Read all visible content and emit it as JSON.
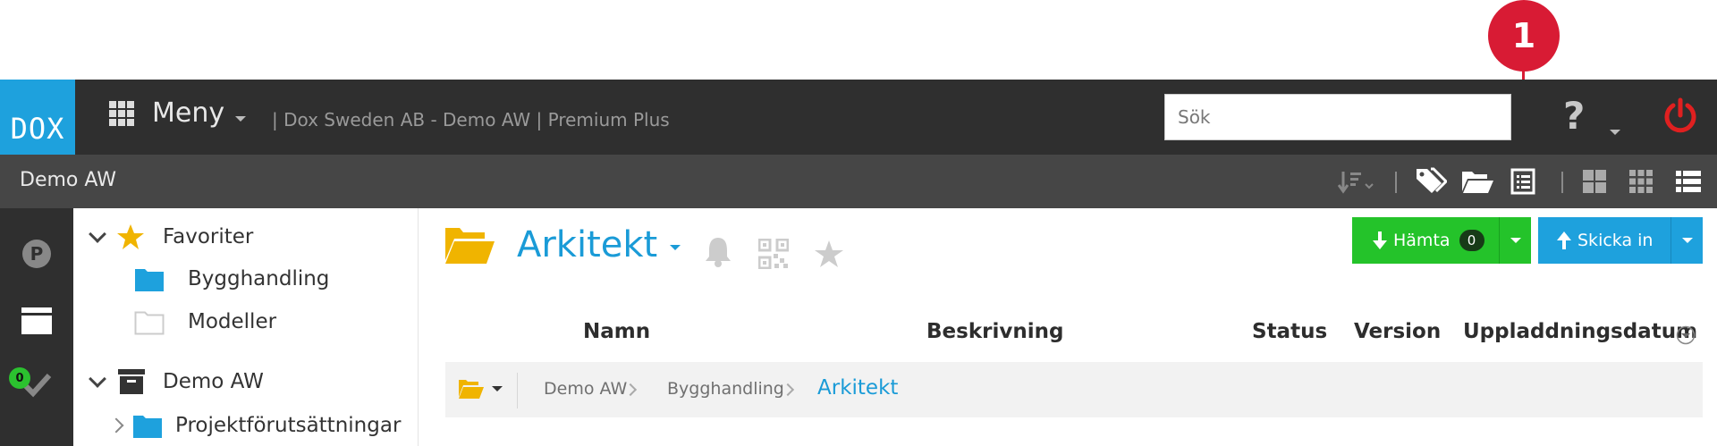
{
  "callout": {
    "number": "1"
  },
  "header": {
    "logo": "DOX",
    "menu_label": "Meny",
    "tenant": "| Dox Sweden AB - Demo AW | Premium Plus",
    "search_placeholder": "Sök",
    "help_label": "?"
  },
  "subbar": {
    "title": "Demo AW",
    "tools": [
      "sort-icon",
      "tags-icon",
      "open-folder-icon",
      "list-details-icon",
      "large-grid-icon",
      "small-grid-icon",
      "list-view-icon"
    ]
  },
  "rail": {
    "tasks_badge": "0",
    "parking_label": "P"
  },
  "tree": {
    "favorites": {
      "label": "Favoriter",
      "items": [
        "Bygghandling",
        "Modeller"
      ]
    },
    "project": {
      "label": "Demo AW",
      "items": [
        "Projektförutsättningar"
      ]
    }
  },
  "main": {
    "folder_title": "Arkitekt",
    "download_label": "Hämta",
    "download_count": "0",
    "upload_label": "Skicka in",
    "columns": [
      "Namn",
      "Beskrivning",
      "Status",
      "Version",
      "Uppladdningsdatum"
    ],
    "breadcrumb": [
      "Demo AW",
      "Bygghandling",
      "Arkitekt"
    ]
  },
  "colors": {
    "accent_blue": "#1ea1dd",
    "accent_green": "#24c32a",
    "callout_red": "#d81b34",
    "header_dark": "#2f2f2f",
    "power_red": "#e02020"
  }
}
